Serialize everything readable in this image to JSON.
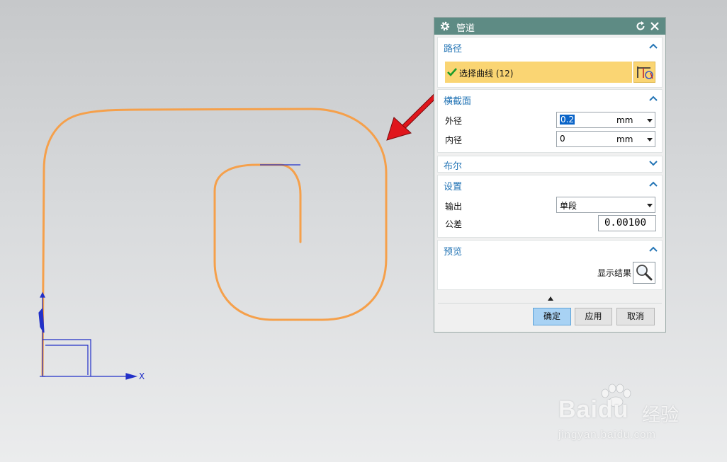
{
  "viewport": {
    "axis_x_label": "X",
    "colors": {
      "curve": "#f5a04b",
      "axis": "#2230c8",
      "arrow": "#e0161c"
    }
  },
  "dialog": {
    "title": "管道",
    "icons": {
      "title": "gear-icon",
      "reset": "reset-icon",
      "close": "close-icon"
    },
    "path_section": {
      "title": "路径",
      "select_curve_label": "选择曲线 (12)"
    },
    "cross_section": {
      "title": "横截面",
      "outer_diameter": {
        "label": "外径",
        "value": "0.2",
        "unit": "mm"
      },
      "inner_diameter": {
        "label": "内径",
        "value": "0",
        "unit": "mm"
      }
    },
    "boolean_section": {
      "title": "布尔"
    },
    "settings_section": {
      "title": "设置",
      "output": {
        "label": "输出",
        "value": "单段"
      },
      "tolerance": {
        "label": "公差",
        "value": "0.00100"
      }
    },
    "preview_section": {
      "title": "预览",
      "show_result_label": "显示结果"
    },
    "buttons": {
      "ok": "确定",
      "apply": "应用",
      "cancel": "取消"
    }
  },
  "watermark": {
    "brand": "Baidu",
    "brand_cn": "经验",
    "url": "jingyan.baidu.com"
  }
}
